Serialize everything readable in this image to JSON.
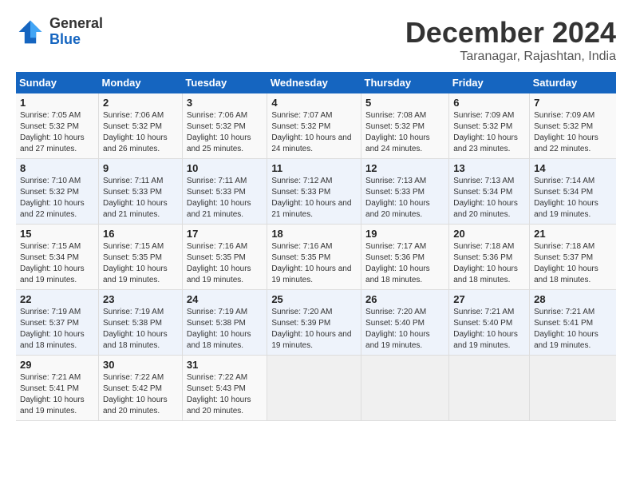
{
  "logo": {
    "general": "General",
    "blue": "Blue"
  },
  "title": {
    "month_year": "December 2024",
    "location": "Taranagar, Rajashtan, India"
  },
  "header": {
    "days": [
      "Sunday",
      "Monday",
      "Tuesday",
      "Wednesday",
      "Thursday",
      "Friday",
      "Saturday"
    ]
  },
  "weeks": [
    [
      {
        "day": "1",
        "sunrise": "Sunrise: 7:05 AM",
        "sunset": "Sunset: 5:32 PM",
        "daylight": "Daylight: 10 hours and 27 minutes."
      },
      {
        "day": "2",
        "sunrise": "Sunrise: 7:06 AM",
        "sunset": "Sunset: 5:32 PM",
        "daylight": "Daylight: 10 hours and 26 minutes."
      },
      {
        "day": "3",
        "sunrise": "Sunrise: 7:06 AM",
        "sunset": "Sunset: 5:32 PM",
        "daylight": "Daylight: 10 hours and 25 minutes."
      },
      {
        "day": "4",
        "sunrise": "Sunrise: 7:07 AM",
        "sunset": "Sunset: 5:32 PM",
        "daylight": "Daylight: 10 hours and 24 minutes."
      },
      {
        "day": "5",
        "sunrise": "Sunrise: 7:08 AM",
        "sunset": "Sunset: 5:32 PM",
        "daylight": "Daylight: 10 hours and 24 minutes."
      },
      {
        "day": "6",
        "sunrise": "Sunrise: 7:09 AM",
        "sunset": "Sunset: 5:32 PM",
        "daylight": "Daylight: 10 hours and 23 minutes."
      },
      {
        "day": "7",
        "sunrise": "Sunrise: 7:09 AM",
        "sunset": "Sunset: 5:32 PM",
        "daylight": "Daylight: 10 hours and 22 minutes."
      }
    ],
    [
      {
        "day": "8",
        "sunrise": "Sunrise: 7:10 AM",
        "sunset": "Sunset: 5:32 PM",
        "daylight": "Daylight: 10 hours and 22 minutes."
      },
      {
        "day": "9",
        "sunrise": "Sunrise: 7:11 AM",
        "sunset": "Sunset: 5:33 PM",
        "daylight": "Daylight: 10 hours and 21 minutes."
      },
      {
        "day": "10",
        "sunrise": "Sunrise: 7:11 AM",
        "sunset": "Sunset: 5:33 PM",
        "daylight": "Daylight: 10 hours and 21 minutes."
      },
      {
        "day": "11",
        "sunrise": "Sunrise: 7:12 AM",
        "sunset": "Sunset: 5:33 PM",
        "daylight": "Daylight: 10 hours and 21 minutes."
      },
      {
        "day": "12",
        "sunrise": "Sunrise: 7:13 AM",
        "sunset": "Sunset: 5:33 PM",
        "daylight": "Daylight: 10 hours and 20 minutes."
      },
      {
        "day": "13",
        "sunrise": "Sunrise: 7:13 AM",
        "sunset": "Sunset: 5:34 PM",
        "daylight": "Daylight: 10 hours and 20 minutes."
      },
      {
        "day": "14",
        "sunrise": "Sunrise: 7:14 AM",
        "sunset": "Sunset: 5:34 PM",
        "daylight": "Daylight: 10 hours and 19 minutes."
      }
    ],
    [
      {
        "day": "15",
        "sunrise": "Sunrise: 7:15 AM",
        "sunset": "Sunset: 5:34 PM",
        "daylight": "Daylight: 10 hours and 19 minutes."
      },
      {
        "day": "16",
        "sunrise": "Sunrise: 7:15 AM",
        "sunset": "Sunset: 5:35 PM",
        "daylight": "Daylight: 10 hours and 19 minutes."
      },
      {
        "day": "17",
        "sunrise": "Sunrise: 7:16 AM",
        "sunset": "Sunset: 5:35 PM",
        "daylight": "Daylight: 10 hours and 19 minutes."
      },
      {
        "day": "18",
        "sunrise": "Sunrise: 7:16 AM",
        "sunset": "Sunset: 5:35 PM",
        "daylight": "Daylight: 10 hours and 19 minutes."
      },
      {
        "day": "19",
        "sunrise": "Sunrise: 7:17 AM",
        "sunset": "Sunset: 5:36 PM",
        "daylight": "Daylight: 10 hours and 18 minutes."
      },
      {
        "day": "20",
        "sunrise": "Sunrise: 7:18 AM",
        "sunset": "Sunset: 5:36 PM",
        "daylight": "Daylight: 10 hours and 18 minutes."
      },
      {
        "day": "21",
        "sunrise": "Sunrise: 7:18 AM",
        "sunset": "Sunset: 5:37 PM",
        "daylight": "Daylight: 10 hours and 18 minutes."
      }
    ],
    [
      {
        "day": "22",
        "sunrise": "Sunrise: 7:19 AM",
        "sunset": "Sunset: 5:37 PM",
        "daylight": "Daylight: 10 hours and 18 minutes."
      },
      {
        "day": "23",
        "sunrise": "Sunrise: 7:19 AM",
        "sunset": "Sunset: 5:38 PM",
        "daylight": "Daylight: 10 hours and 18 minutes."
      },
      {
        "day": "24",
        "sunrise": "Sunrise: 7:19 AM",
        "sunset": "Sunset: 5:38 PM",
        "daylight": "Daylight: 10 hours and 18 minutes."
      },
      {
        "day": "25",
        "sunrise": "Sunrise: 7:20 AM",
        "sunset": "Sunset: 5:39 PM",
        "daylight": "Daylight: 10 hours and 19 minutes."
      },
      {
        "day": "26",
        "sunrise": "Sunrise: 7:20 AM",
        "sunset": "Sunset: 5:40 PM",
        "daylight": "Daylight: 10 hours and 19 minutes."
      },
      {
        "day": "27",
        "sunrise": "Sunrise: 7:21 AM",
        "sunset": "Sunset: 5:40 PM",
        "daylight": "Daylight: 10 hours and 19 minutes."
      },
      {
        "day": "28",
        "sunrise": "Sunrise: 7:21 AM",
        "sunset": "Sunset: 5:41 PM",
        "daylight": "Daylight: 10 hours and 19 minutes."
      }
    ],
    [
      {
        "day": "29",
        "sunrise": "Sunrise: 7:21 AM",
        "sunset": "Sunset: 5:41 PM",
        "daylight": "Daylight: 10 hours and 19 minutes."
      },
      {
        "day": "30",
        "sunrise": "Sunrise: 7:22 AM",
        "sunset": "Sunset: 5:42 PM",
        "daylight": "Daylight: 10 hours and 20 minutes."
      },
      {
        "day": "31",
        "sunrise": "Sunrise: 7:22 AM",
        "sunset": "Sunset: 5:43 PM",
        "daylight": "Daylight: 10 hours and 20 minutes."
      },
      null,
      null,
      null,
      null
    ]
  ]
}
